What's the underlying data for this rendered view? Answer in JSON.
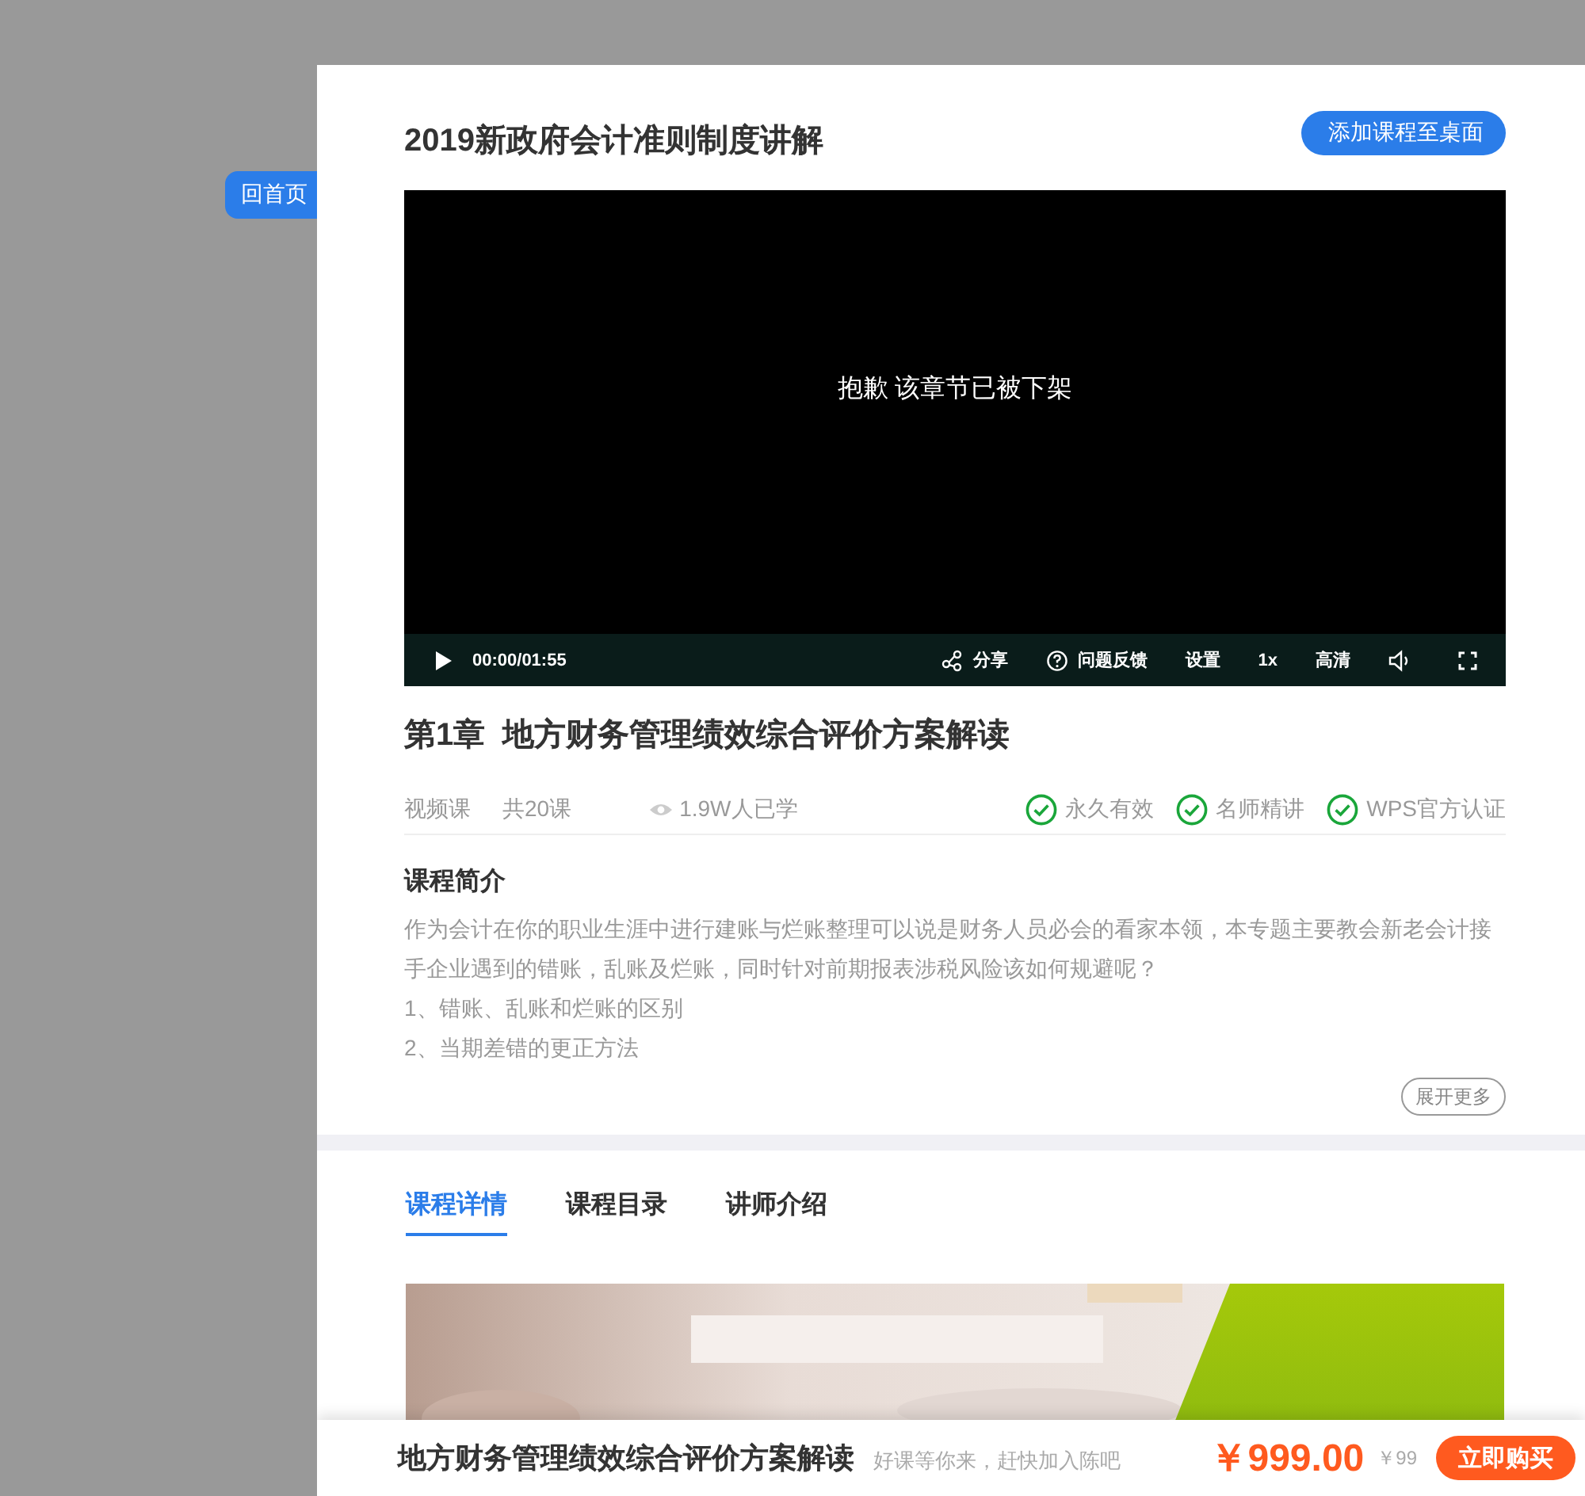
{
  "home_button": "回首页",
  "course_title": "2019新政府会计准则制度讲解",
  "add_to_desktop_button": "添加课程至桌面",
  "video": {
    "message": "抱歉 该章节已被下架",
    "time": "00:00/01:55",
    "controls": [
      {
        "kind": "share",
        "label": "分享"
      },
      {
        "kind": "help",
        "label": "问题反馈"
      },
      {
        "kind": "text",
        "label": "设置"
      },
      {
        "kind": "text",
        "label": "1x"
      },
      {
        "kind": "text",
        "label": "高清"
      }
    ]
  },
  "chapter_title": "第1章  地方财务管理绩效综合评价方案解读",
  "meta": {
    "type": "视频课",
    "lessons": "共20课",
    "learners": "1.9W人已学"
  },
  "badges": [
    "永久有效",
    "名师精讲",
    "WPS官方认证"
  ],
  "intro": {
    "heading": "课程简介",
    "paragraphs": [
      "作为会计在你的职业生涯中进行建账与烂账整理可以说是财务人员必会的看家本领，本专题主要教会新老会计接手企业遇到的错账，乱账及烂账，同时针对前期报表涉税风险该如何规避呢？",
      "1、错账、乱账和烂账的区别",
      "2、当期差错的更正方法"
    ],
    "more_button": "展开更多"
  },
  "tabs": [
    {
      "label": "课程详情",
      "selected": true
    },
    {
      "label": "课程目录",
      "selected": false
    },
    {
      "label": "讲师介绍",
      "selected": false
    }
  ],
  "buy_bar": {
    "title": "地方财务管理绩效综合评价方案解读",
    "slogan": "好课等你来，赶快加入陈吧",
    "price": "￥999.00",
    "original_price": "￥99",
    "buy_button": "立即购买"
  }
}
